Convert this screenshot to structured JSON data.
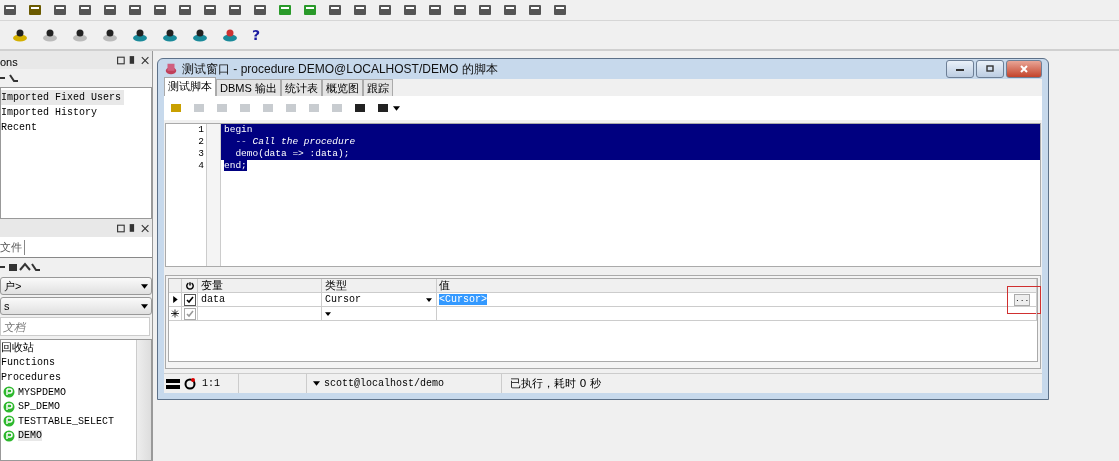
{
  "toolbar": {
    "help_glyph": "?"
  },
  "connections_panel": {
    "title": "ons",
    "items": [
      {
        "label": "Imported Fixed Users",
        "selected": true
      },
      {
        "label": "Imported History",
        "selected": false
      },
      {
        "label": "Recent",
        "selected": false
      }
    ]
  },
  "objects_panel": {
    "tab": "文件",
    "user_select": "户>",
    "type_select": "s",
    "search_placeholder": "文档",
    "tree": [
      {
        "label": "回收站"
      },
      {
        "label": "Functions"
      },
      {
        "label": "Procedures",
        "children": [
          {
            "label": "MYSPDEMO",
            "kind": "procedure",
            "selected": false
          },
          {
            "label": "SP_DEMO",
            "kind": "procedure",
            "selected": false
          },
          {
            "label": "TESTTABLE_SELECT",
            "kind": "procedure",
            "selected": false
          },
          {
            "label": "DEMO",
            "kind": "procedure",
            "selected": true
          }
        ]
      }
    ]
  },
  "test_window": {
    "title": "测试窗口 - procedure DEMO@LOCALHOST/DEMO 的脚本",
    "tabs": [
      {
        "label": "测试脚本",
        "selected": true
      },
      {
        "label": "DBMS 输出",
        "selected": false
      },
      {
        "label": "统计表",
        "selected": false
      },
      {
        "label": "概览图",
        "selected": false
      },
      {
        "label": "跟踪",
        "selected": false
      }
    ],
    "code_lines": [
      {
        "number": "1",
        "text": "begin",
        "kind": "code",
        "selected": true
      },
      {
        "number": "2",
        "text": "  -- Call the procedure",
        "kind": "comment",
        "selected": true
      },
      {
        "number": "3",
        "text": "  demo(data => :data);",
        "kind": "code",
        "selected": true
      },
      {
        "number": "4",
        "text": "end;",
        "kind": "code",
        "selected": true
      }
    ],
    "variables": {
      "columns": [
        "变量",
        "类型",
        "值"
      ],
      "rows": [
        {
          "kind": "current",
          "checked": true,
          "disabled": false,
          "name": "data",
          "type": "Cursor",
          "value": "<Cursor>",
          "value_selected": true,
          "button": "..."
        },
        {
          "kind": "new",
          "checked": true,
          "disabled": true,
          "name": "",
          "type": "",
          "value": ""
        }
      ]
    },
    "status_bar": {
      "position": "1:1",
      "connection": "scott@localhost/demo",
      "message": "已执行，耗时 0 秒"
    }
  }
}
